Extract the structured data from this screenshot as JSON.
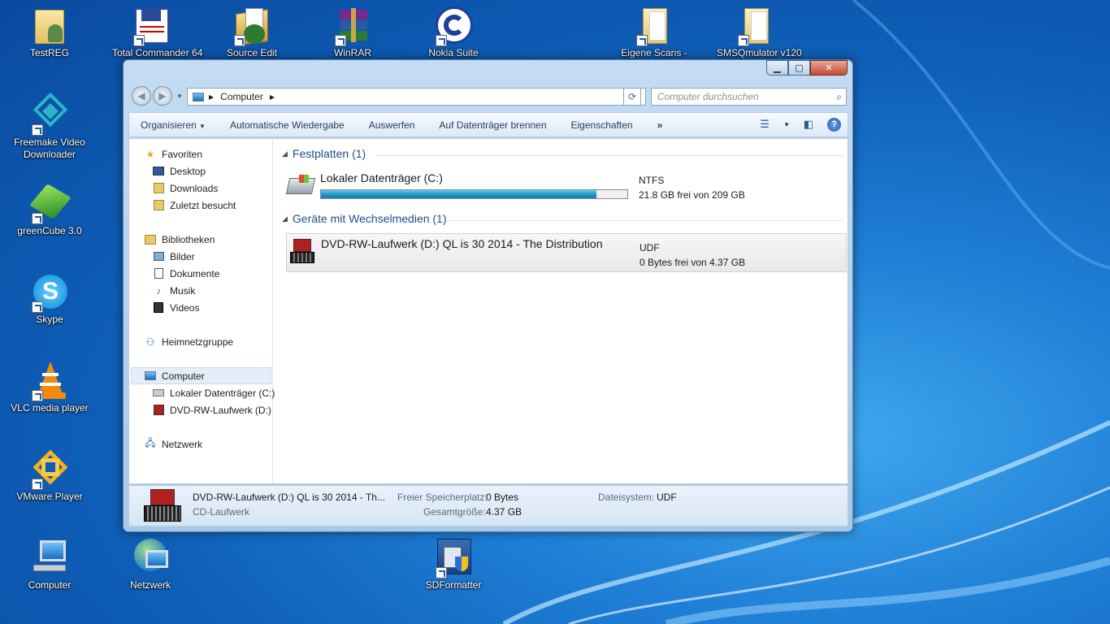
{
  "desktop": {
    "icons": [
      {
        "label": "TestREG"
      },
      {
        "label": "Total Commander 64"
      },
      {
        "label": "Source Edit"
      },
      {
        "label": "WinRAR"
      },
      {
        "label": "Nokia Suite"
      },
      {
        "label": "Eigene Scans -"
      },
      {
        "label": "SMSQmulator v120"
      },
      {
        "label": "Freemake Video Downloader"
      },
      {
        "label": "greenCube 3.0"
      },
      {
        "label": "Skype"
      },
      {
        "label": "VLC media player"
      },
      {
        "label": "VMware Player"
      },
      {
        "label": "Computer"
      },
      {
        "label": "Netzwerk"
      },
      {
        "label": "SDFormatter"
      }
    ]
  },
  "window": {
    "address": {
      "crumb": "Computer"
    },
    "search": {
      "placeholder": "Computer durchsuchen"
    },
    "toolbar": {
      "items": [
        "Organisieren",
        "Automatische Wiedergabe",
        "Auswerfen",
        "Auf Datenträger brennen",
        "Eigenschaften"
      ],
      "more": "»"
    },
    "nav": {
      "favorites": "Favoriten",
      "desktop": "Desktop",
      "downloads": "Downloads",
      "recent": "Zuletzt besucht",
      "libraries": "Bibliotheken",
      "pictures": "Bilder",
      "documents": "Dokumente",
      "music": "Musik",
      "videos": "Videos",
      "homegroup": "Heimnetzgruppe",
      "computer": "Computer",
      "drive_c": "Lokaler Datenträger (C:)",
      "drive_d": "DVD-RW-Laufwerk (D:)",
      "network": "Netzwerk"
    },
    "groups": {
      "hdd": "Festplatten (1)",
      "removable": "Geräte mit Wechselmedien (1)"
    },
    "drives": {
      "c": {
        "name": "Lokaler Datenträger (C:)",
        "fs": "NTFS",
        "free": "21.8 GB frei von 209 GB",
        "used_fraction": 0.9
      },
      "d": {
        "name": "DVD-RW-Laufwerk (D:) QL is 30 2014 - The Distribution",
        "fs": "UDF",
        "free": "0 Bytes frei von 4.37 GB"
      }
    },
    "details": {
      "title": "DVD-RW-Laufwerk (D:) QL is 30 2014 - Th...",
      "type": "CD-Laufwerk",
      "free_label": "Freier Speicherplatz:",
      "free_value": "0 Bytes",
      "total_label": "Gesamtgröße:",
      "total_value": "4.37 GB",
      "fs_label": "Dateisystem:",
      "fs_value": "UDF"
    }
  }
}
